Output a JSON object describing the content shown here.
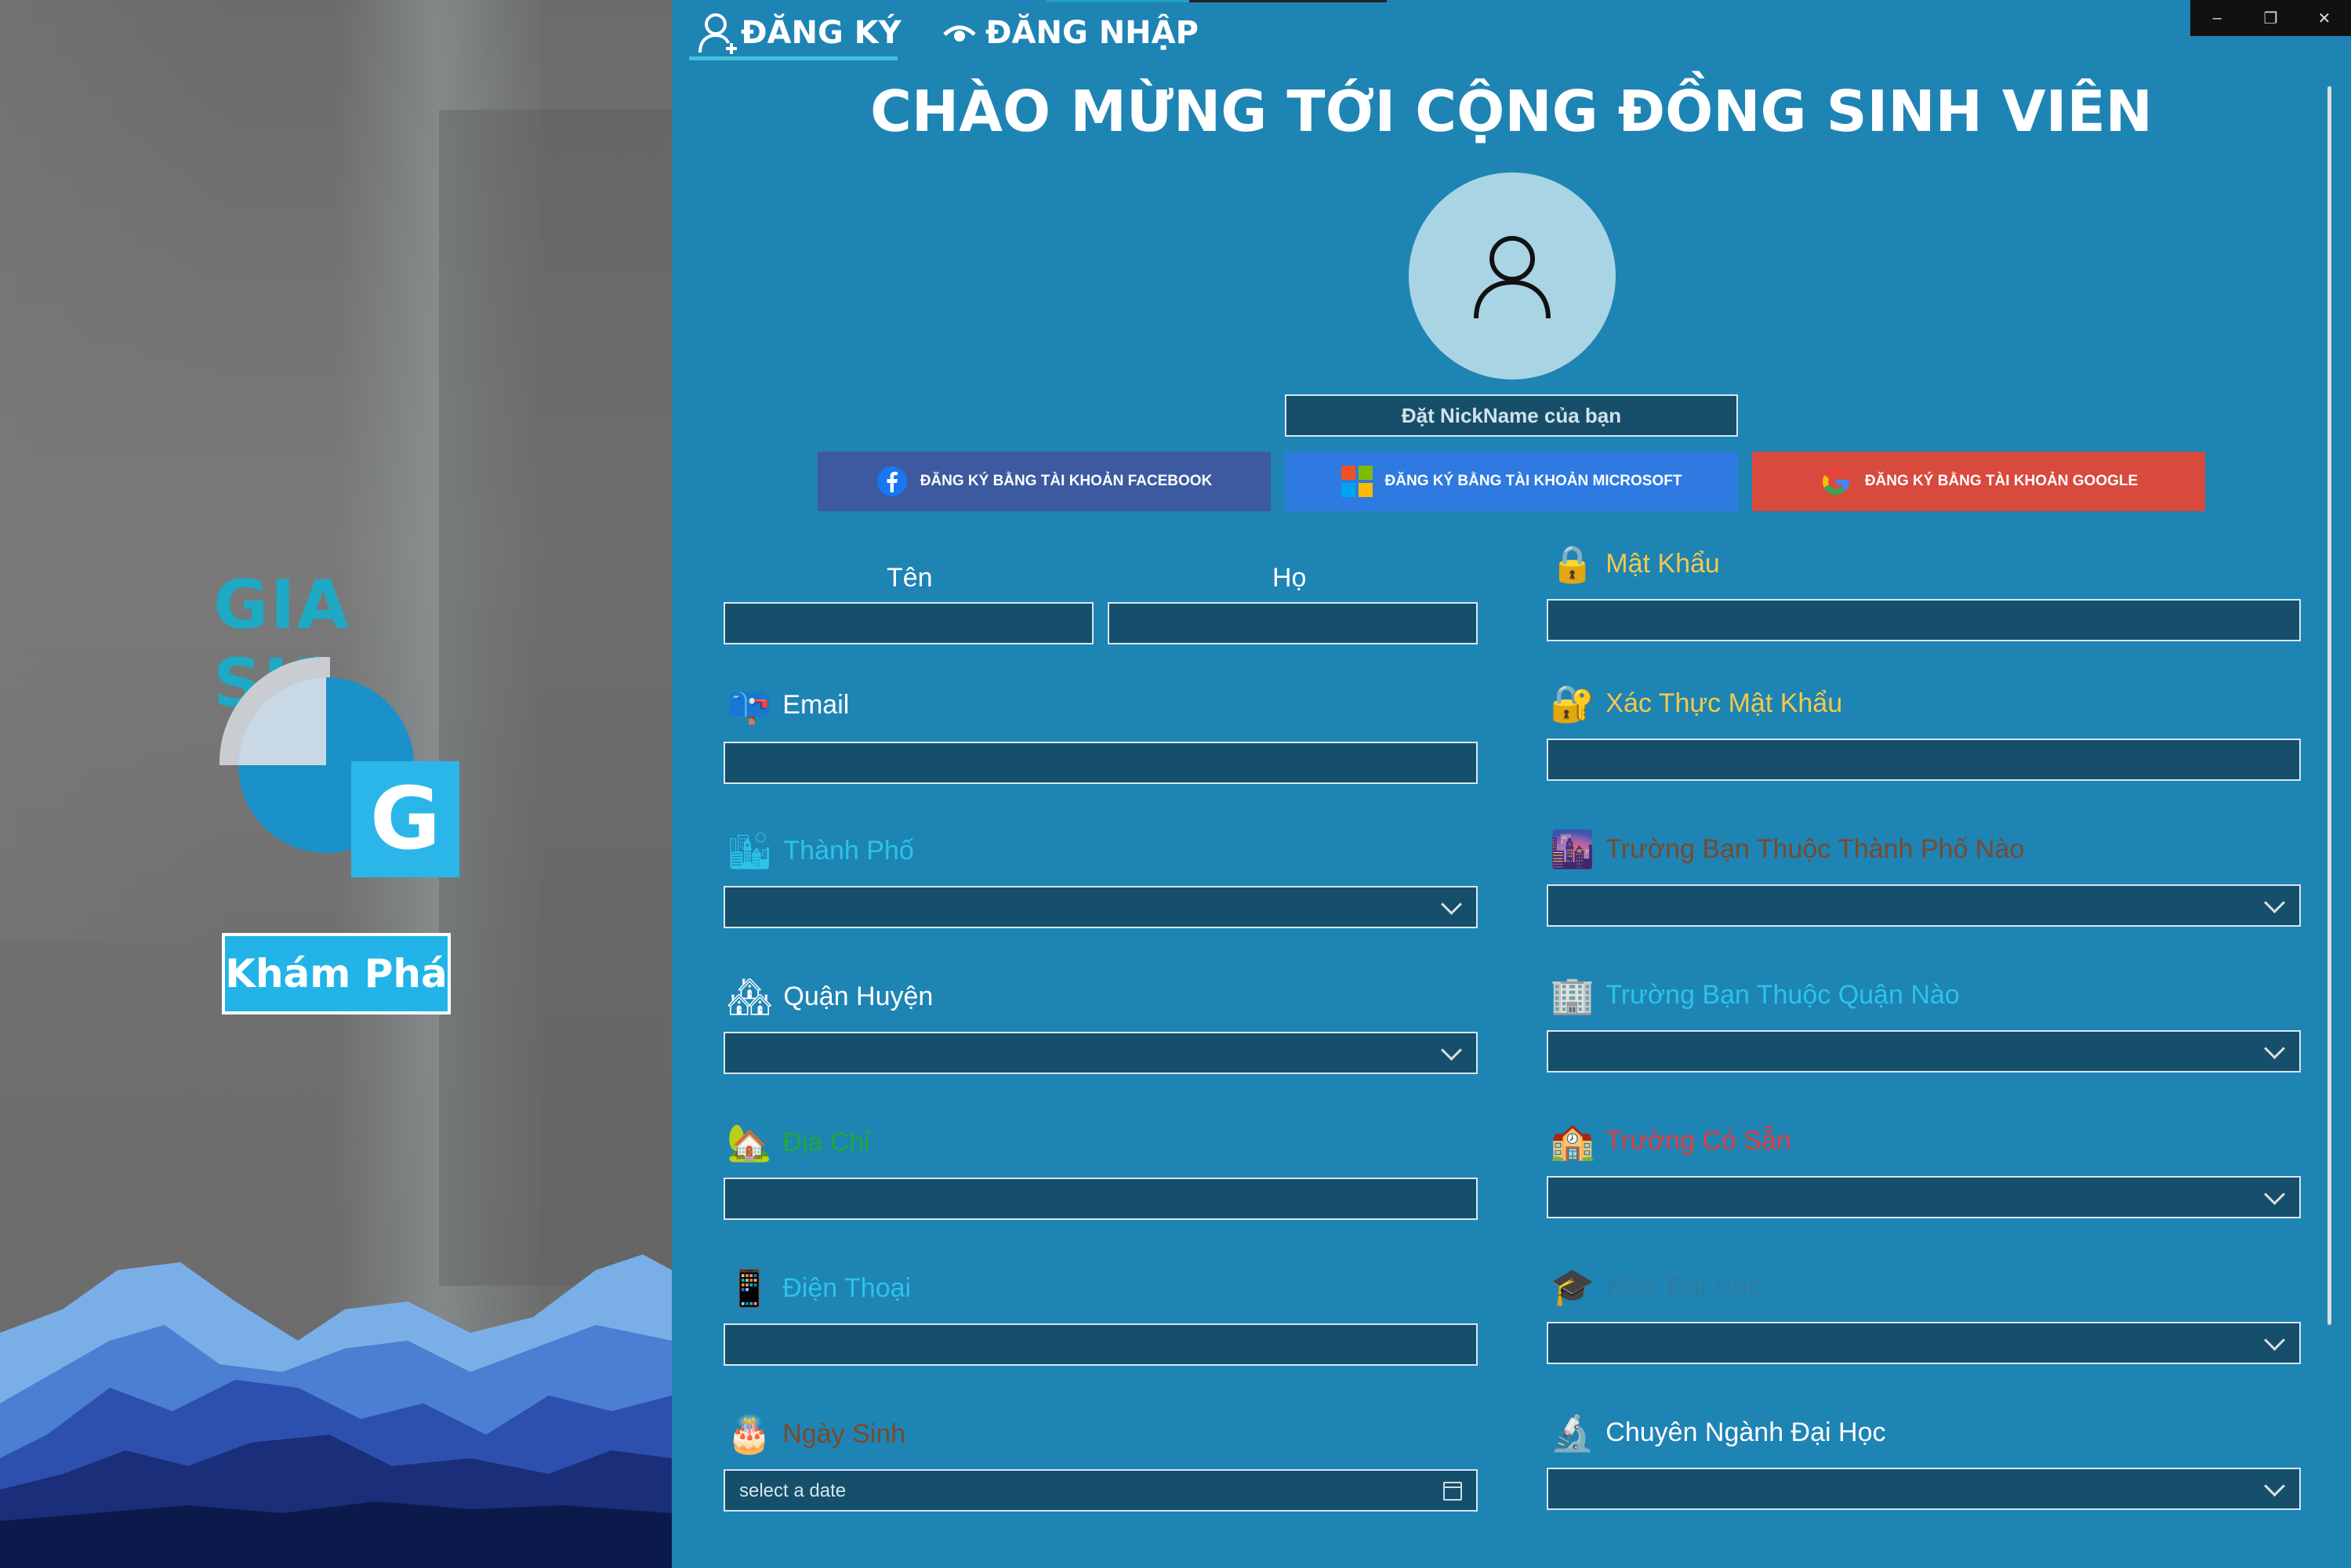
{
  "left_panel": {
    "brand_title": "GIA SƯ",
    "logo_letter": "G",
    "explore_label": "Khám Phá"
  },
  "tabs": [
    {
      "label": "ĐĂNG KÝ",
      "icon": "add-user-icon",
      "active": true
    },
    {
      "label": "ĐĂNG NHẬP",
      "icon": "eye-icon",
      "active": false
    }
  ],
  "window_controls": {
    "minimize": "–",
    "restore": "❐",
    "close": "✕"
  },
  "header": {
    "headline": "CHÀO MỪNG TỚI CỘNG ĐỒNG SINH VIÊN"
  },
  "profile": {
    "nickname_placeholder": "Đặt NickName của bạn"
  },
  "social_signup": {
    "facebook_label": "ĐĂNG KÝ BẰNG TÀI KHOẢN FACEBOOK",
    "microsoft_label": "ĐĂNG KÝ BẰNG TÀI KHOẢN MICROSOFT",
    "google_label": "ĐĂNG KÝ BẰNG TÀI KHOẢN GOOGLE",
    "facebook_color": "#3d5aa0",
    "microsoft_color": "#2e7ae0",
    "google_color": "#d84a3e"
  },
  "form": {
    "first_name_label": "Tên",
    "last_name_label": "Họ",
    "email_label": "Email",
    "city_label": "Thành Phố",
    "district_label": "Quận Huyện",
    "address_label": "Địa Chỉ",
    "phone_label": "Điện Thoại",
    "birthday_label": "Ngày Sinh",
    "birthday_placeholder": "select a date",
    "password_label": "Mật Khẩu",
    "confirm_password_label": "Xác Thực Mật Khẩu",
    "school_city_label": "Trường Bạn Thuộc Thành Phố Nào",
    "school_district_label": "Trường Bạn Thuộc Quận Nào",
    "existing_school_label": "Trường Có Sẵn",
    "university_block_label": "Khối Đại Học",
    "major_label": "Chuyên Ngành Đại Học"
  },
  "label_colors": {
    "white": "#ffffff",
    "yellow": "#f2c94c",
    "cyan": "#2bc4e4",
    "green": "#1faa3a",
    "red": "#e83a3a",
    "brown": "#7a4a2a",
    "muted": "#2f7aa0"
  }
}
